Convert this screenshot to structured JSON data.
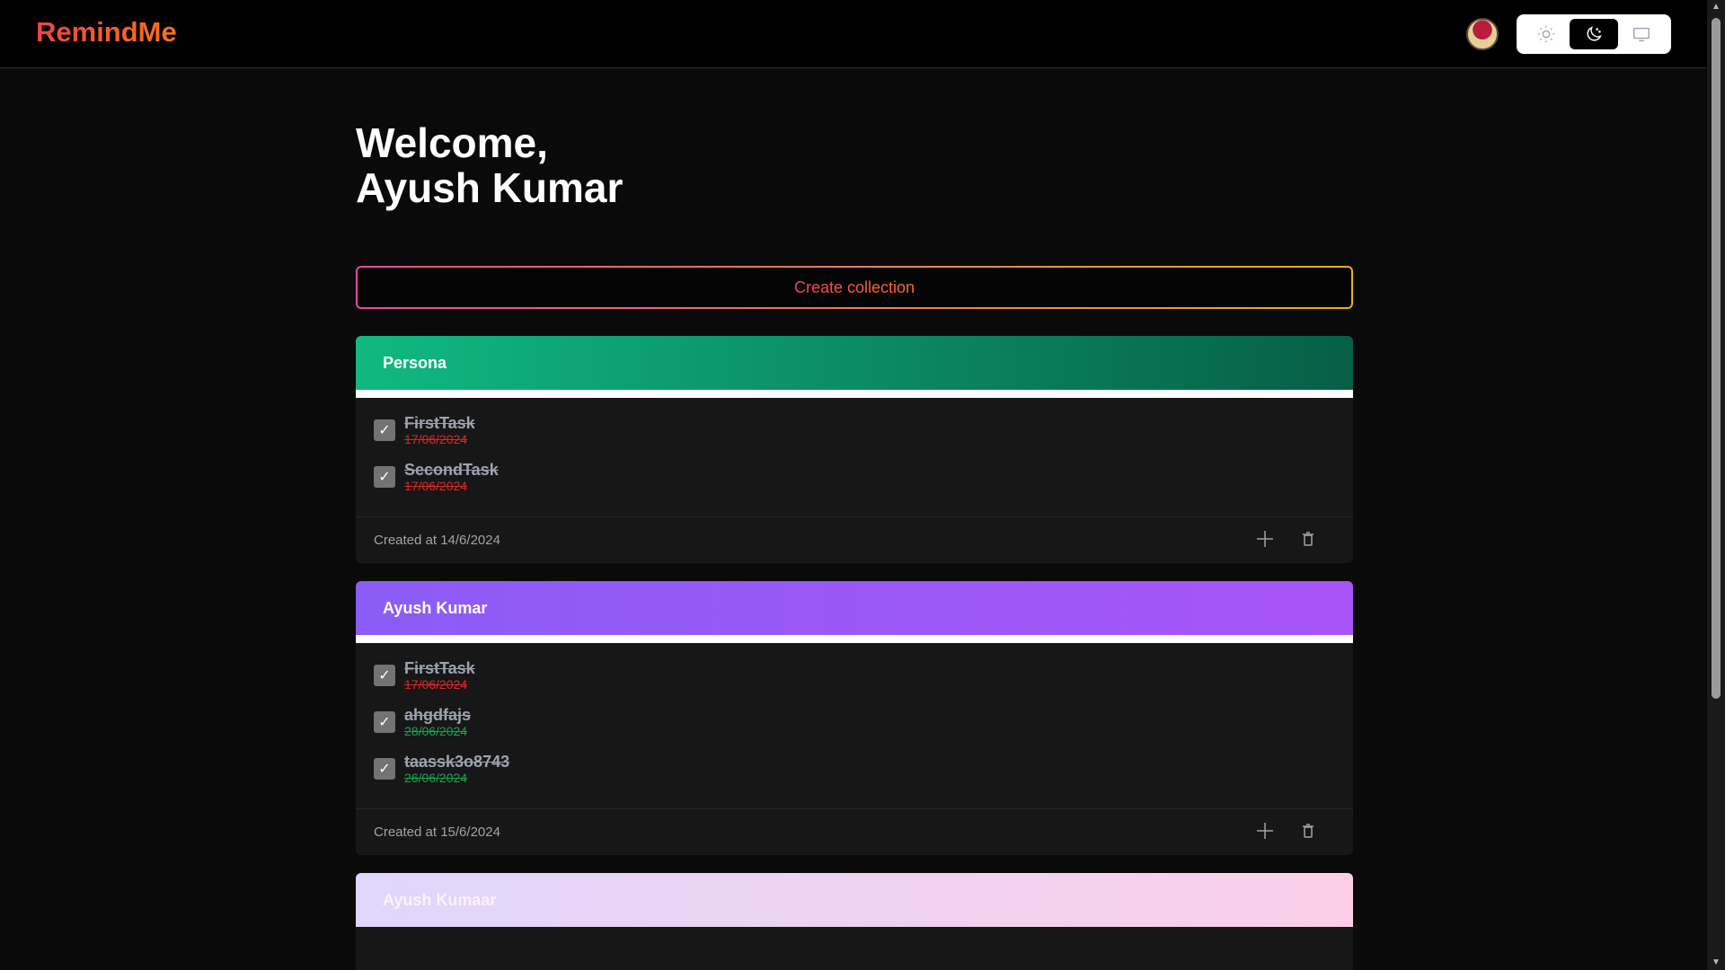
{
  "app": {
    "logo": "RemindMe",
    "brand_gradient": [
      "#ef4444",
      "#f97316"
    ]
  },
  "theme_switcher": {
    "options": [
      {
        "icon": "sun-icon",
        "mode": "light"
      },
      {
        "icon": "moon-icon",
        "mode": "dark",
        "active": true
      },
      {
        "icon": "monitor-icon",
        "mode": "system"
      }
    ]
  },
  "welcome": {
    "line1": "Welcome,",
    "line2": "Ayush Kumar"
  },
  "create_button": {
    "label": "Create collection"
  },
  "collections": [
    {
      "title": "Persona",
      "color": "emerald",
      "tasks": [
        {
          "name": "FirstTask",
          "date": "17/06/2024",
          "done": true,
          "date_color": "red"
        },
        {
          "name": "SecondTask",
          "date": "17/06/2024",
          "done": true,
          "date_color": "red"
        }
      ],
      "created": "Created at 14/6/2024"
    },
    {
      "title": "Ayush Kumar",
      "color": "violet",
      "tasks": [
        {
          "name": "FirstTask",
          "date": "17/06/2024",
          "done": true,
          "date_color": "red"
        },
        {
          "name": "ahgdfajs",
          "date": "28/06/2024",
          "done": true,
          "date_color": "green"
        },
        {
          "name": "taassk3o8743",
          "date": "26/06/2024",
          "done": true,
          "date_color": "green"
        }
      ],
      "created": "Created at 15/6/2024"
    },
    {
      "title": "Ayush Kumaar",
      "color": "pink",
      "tasks": [],
      "created": ""
    }
  ],
  "colors": {
    "background": "#0a0a0a",
    "card": "#171717",
    "muted_text": "#a3a3a3",
    "overdue": "#dc2626",
    "upcoming": "#16a34a"
  }
}
